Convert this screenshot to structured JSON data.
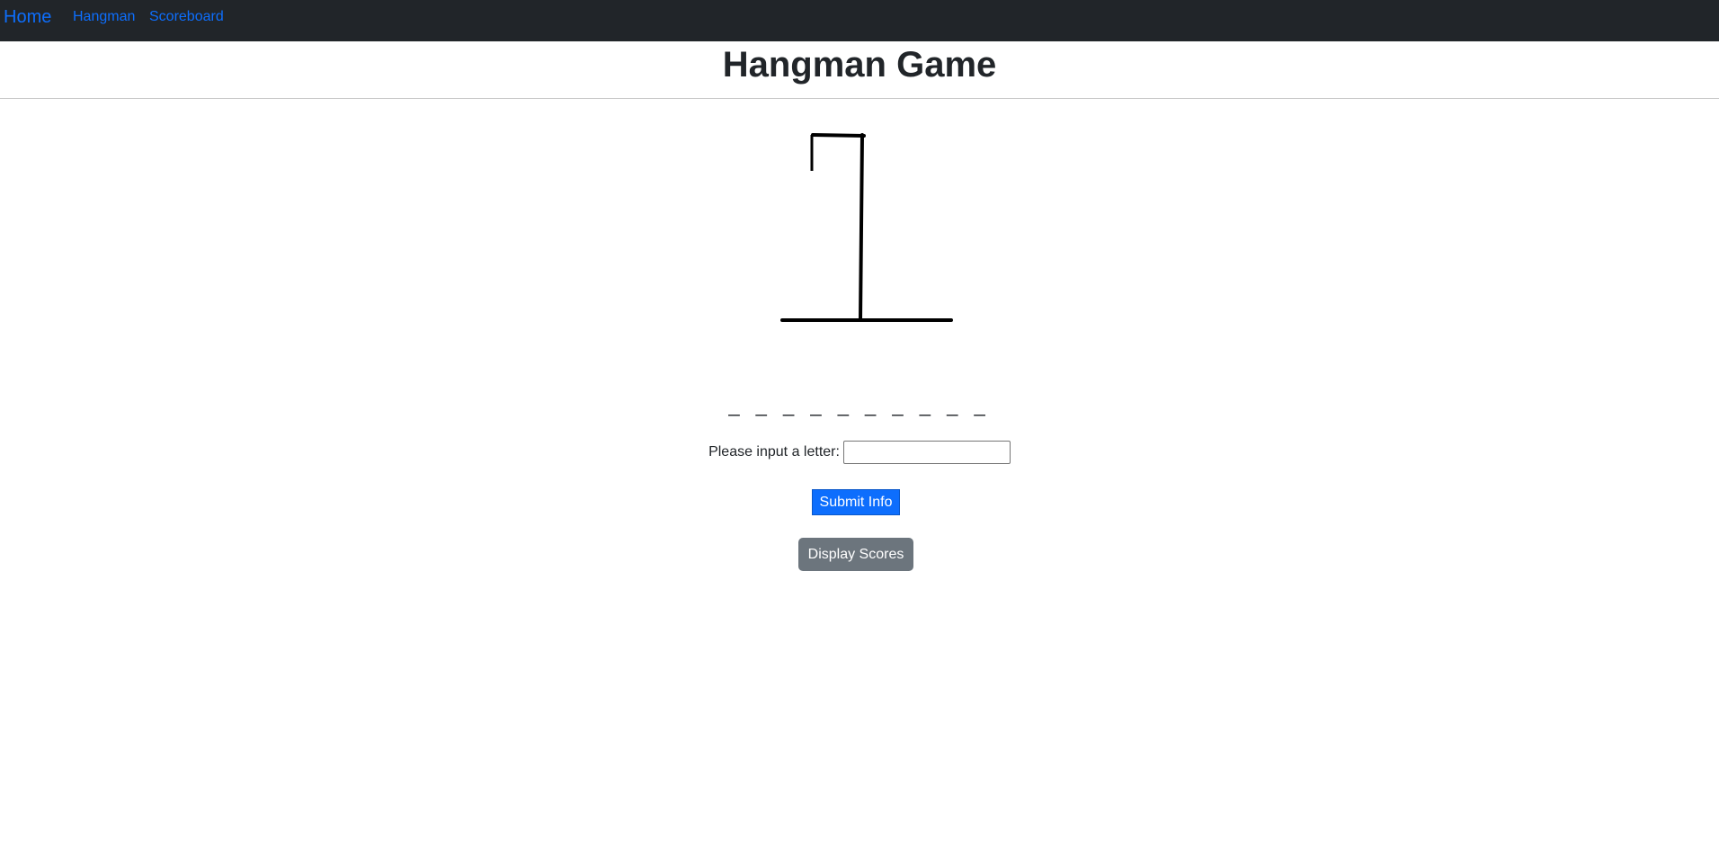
{
  "nav": {
    "brand": "Home",
    "links": [
      "Hangman",
      "Scoreboard"
    ]
  },
  "page": {
    "title": "Hangman Game"
  },
  "game": {
    "word_display": "_ _ _ _ _ _ _ _ _ _",
    "wrong_guesses_drawn": 0
  },
  "form": {
    "label": "Please input a letter:",
    "input_value": "",
    "submit_label": "Submit Info"
  },
  "scores_button": "Display Scores",
  "colors": {
    "navbar_bg": "#212529",
    "link": "#0d6efd",
    "primary_button": "#0d6efd",
    "secondary_button": "#6c757d"
  }
}
